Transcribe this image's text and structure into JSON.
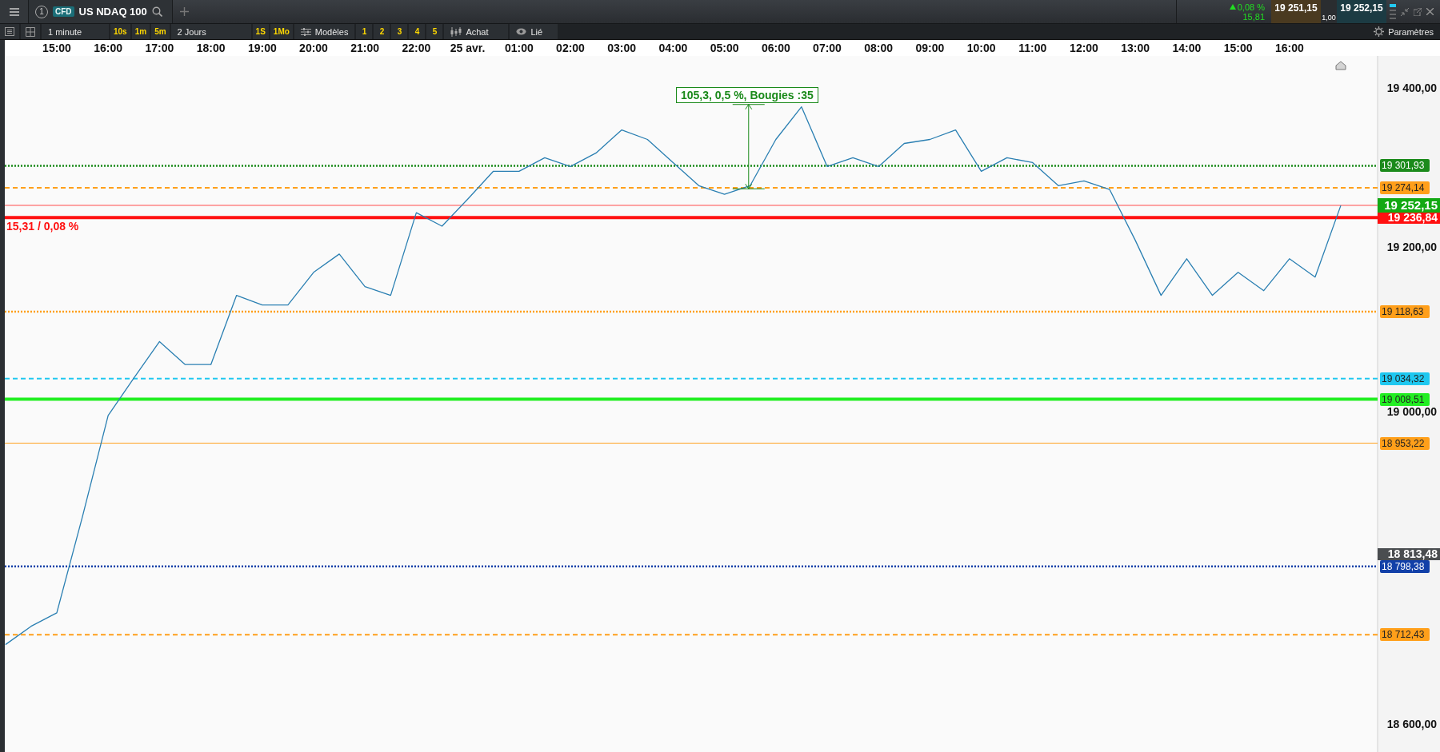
{
  "top_bar": {
    "tab_number": "1",
    "instrument_type": "CFD",
    "instrument": "US NDAQ 100",
    "change_percent": "0,08 %",
    "change_points": "15,81",
    "sell_price": "19 251,15",
    "buy_price": "19 252,15",
    "spread": "1,00"
  },
  "toolbar": {
    "interval": "1 minute",
    "quick_intervals": [
      "10s",
      "1m",
      "5m"
    ],
    "period": "2 Jours",
    "quick_periods": [
      "1S",
      "1Mo"
    ],
    "templates": "Modèles",
    "slots": [
      "1",
      "2",
      "3",
      "4",
      "5"
    ],
    "order": "Achat",
    "link": "Lié",
    "settings": "Paramètres"
  },
  "chart": {
    "chart_data": {
      "type": "line",
      "categories": [
        null,
        null,
        "15:00",
        null,
        "16:00",
        null,
        "17:00",
        null,
        "18:00",
        null,
        "19:00",
        null,
        "20:00",
        null,
        "21:00",
        null,
        "22:00",
        null,
        "25 avr.",
        null,
        "01:00",
        null,
        "02:00",
        null,
        "03:00",
        null,
        "04:00",
        null,
        "05:00",
        null,
        "06:00",
        null,
        "07:00",
        null,
        "08:00",
        null,
        "09:00",
        null,
        "10:00",
        null,
        "11:00",
        null,
        "12:00",
        null,
        "13:00",
        null,
        "14:00",
        null,
        "15:00",
        null,
        "16:00",
        null,
        null
      ],
      "series": [
        {
          "color": "#2a7fb2",
          "values": [
            18700,
            18723,
            18740,
            18861,
            18988,
            19035,
            19081,
            19052,
            19052,
            19139,
            19127,
            19127,
            19168,
            19191,
            19150,
            19139,
            19243,
            19226,
            19260,
            19295,
            19295,
            19312,
            19301,
            19318,
            19347,
            19335,
            19306,
            19277,
            19266,
            19277,
            19335,
            19376,
            19301,
            19312,
            19301,
            19330,
            19335,
            19347,
            19295,
            19312,
            19306,
            19277,
            19283,
            19272,
            19208,
            19139,
            19185,
            19139,
            19168,
            19145,
            19185,
            19162,
            19252
          ]
        }
      ],
      "ylim": [
        18564,
        19440
      ],
      "yticks": [
        {
          "value": 19400,
          "label": "19 400,00"
        },
        {
          "value": 19200,
          "label": "19 200,00"
        },
        {
          "value": 19000,
          "label": "19 000,00"
        },
        {
          "value": 18600,
          "label": "18 600,00"
        }
      ],
      "ref_lines": [
        {
          "axis": "y",
          "value": 19301.93,
          "color": "#1b8a1b"
        },
        {
          "axis": "y",
          "value": 19274.14,
          "color": "#ff9f1a"
        },
        {
          "axis": "y",
          "value": 19252.15,
          "color": "#ff4a4a"
        },
        {
          "axis": "y",
          "value": 19236.84,
          "color": "#ff1010"
        },
        {
          "axis": "y",
          "value": 19118.63,
          "color": "#ff9f1a"
        },
        {
          "axis": "y",
          "value": 19034.32,
          "color": "#1fc8f0"
        },
        {
          "axis": "y",
          "value": 19008.51,
          "color": "#22ee22"
        },
        {
          "axis": "y",
          "value": 18953.22,
          "color": "#ff9f1a"
        },
        {
          "axis": "y",
          "value": 18798.38,
          "color": "#1240a8"
        },
        {
          "axis": "y",
          "value": 18712.43,
          "color": "#ff9f1a"
        }
      ]
    },
    "level_tags": [
      {
        "label": "19 301,93",
        "kind": "dotted"
      },
      {
        "label": "19 274,14",
        "kind": "dashed"
      },
      {
        "label": "19 252,15",
        "kind": "bid"
      },
      {
        "label": "19 236,84",
        "kind": "stop"
      },
      {
        "label": "19 118,63",
        "kind": "dotted"
      },
      {
        "label": "19 034,32",
        "kind": "dashed"
      },
      {
        "label": "19 008,51",
        "kind": "thick"
      },
      {
        "label": "18 953,22",
        "kind": "thin"
      },
      {
        "label": "18 813,48",
        "kind": "marker",
        "color": "#4a4d50"
      },
      {
        "label": "18 798,38",
        "kind": "dotted"
      },
      {
        "label": "18 712,43",
        "kind": "dashed"
      }
    ],
    "change_note": "15,31 / 0,08 %",
    "measure_label": "105,3, 0,5 %, Bougies :35"
  }
}
